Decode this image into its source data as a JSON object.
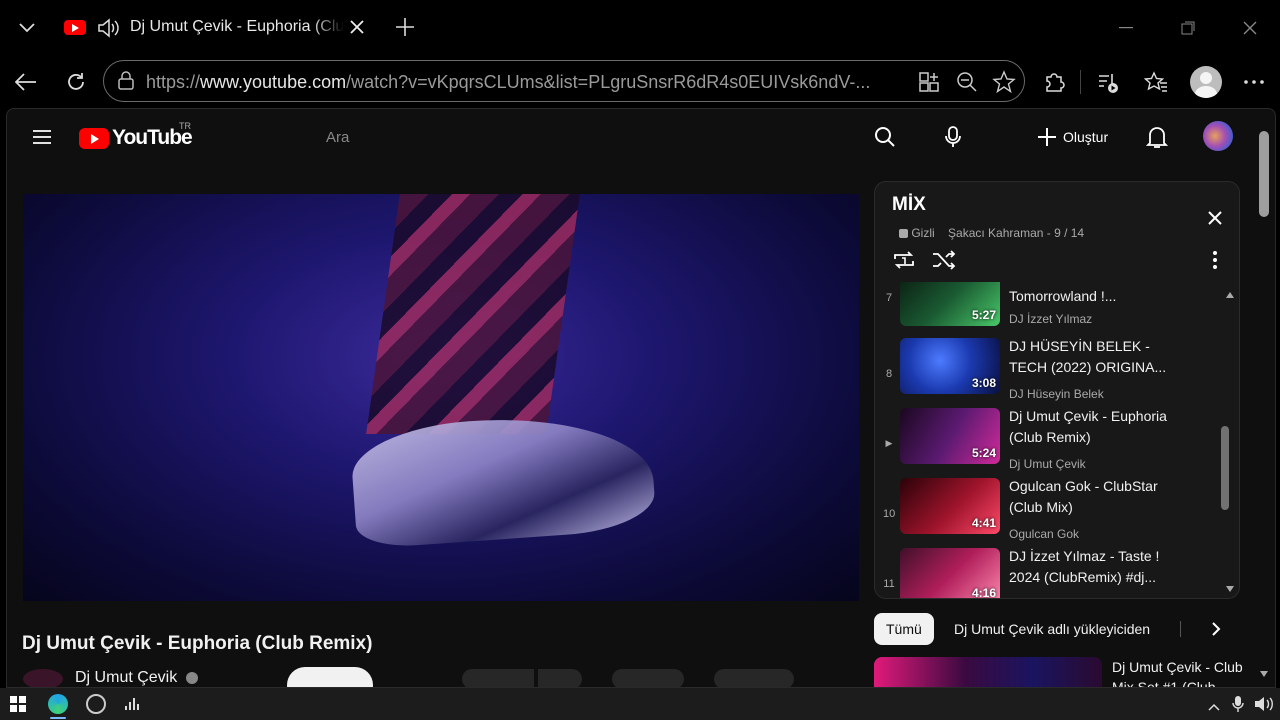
{
  "browser": {
    "tab_title": "Dj Umut Çevik - Euphoria (Clu",
    "url_prefix": "https://",
    "url_domain": "www.youtube.com",
    "url_rest": "/watch?v=vKpqrsCLUms&list=PLgruSnsrR6dR4s0EUIVsk6ndV-..."
  },
  "youtube": {
    "logo_text": "YouTube",
    "country": "TR",
    "search_placeholder": "Ara",
    "create_label": "Oluştur"
  },
  "video": {
    "title": "Dj Umut Çevik - Euphoria (Club Remix)",
    "channel": "Dj Umut Çevik"
  },
  "playlist": {
    "title": "MİX",
    "privacy": "Gizli",
    "owner_progress": "Şakacı Kahraman - 9 / 14",
    "items": [
      {
        "index": "7",
        "title": "Tomorrowland !...",
        "channel": "DJ İzzet Yılmaz",
        "duration": "5:27",
        "color": "#1a5a32"
      },
      {
        "index": "8",
        "title": "DJ HÜSEYİN BELEK - TECH (2022) ORIGINA...",
        "channel": "DJ Hüseyin Belek",
        "duration": "3:08",
        "color": "#1b3ab0"
      },
      {
        "index": "▶",
        "title": "Dj Umut Çevik - Euphoria (Club Remix)",
        "channel": "Dj Umut Çevik",
        "duration": "5:24",
        "color": "#5a1a70"
      },
      {
        "index": "10",
        "title": "Ogulcan Gok - ClubStar (Club Mix)",
        "channel": "Ogulcan Gok",
        "duration": "4:41",
        "color": "#a0142c"
      },
      {
        "index": "11",
        "title": "DJ İzzet Yılmaz - Taste ! 2024 (ClubRemix) #dj...",
        "channel": "",
        "duration": "4:16",
        "color": "#b01e5a"
      }
    ]
  },
  "chips": {
    "all": "Tümü",
    "uploader": "Dj Umut Çevik adlı yükleyiciden"
  },
  "next_video": {
    "title": "Dj Umut Çevik - Club Mix Set #1 (Club"
  }
}
